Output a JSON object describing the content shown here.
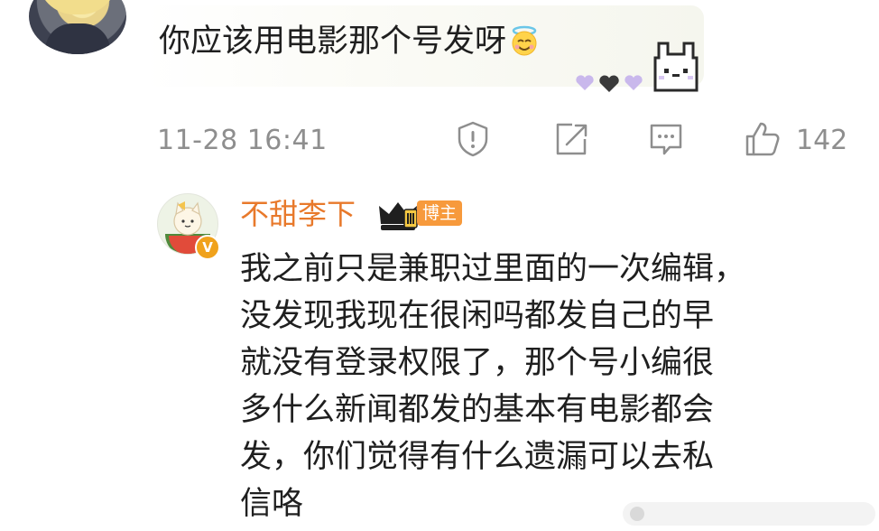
{
  "comment": {
    "text": "你应该用电影那个号发呀",
    "timestamp": "11-28 16:41",
    "like_count": "142",
    "icons": [
      "report-icon",
      "share-icon",
      "comment-icon",
      "like-icon"
    ]
  },
  "reply": {
    "username": "不甜李下",
    "badge": "博主",
    "lines": [
      "我之前只是兼职过里面的一次编辑，",
      "没发现我现在很闲吗都发自己的早",
      "就没有登录权限了，那个号小编很",
      "多什么新闻都发的基本有电影都会",
      "发，你们觉得有什么遗漏可以去私",
      "信咯"
    ]
  },
  "colors": {
    "username": "#e8792b",
    "badge": "#f79a3c",
    "meta": "#8e8e8e",
    "verified": "#f0a21c"
  }
}
